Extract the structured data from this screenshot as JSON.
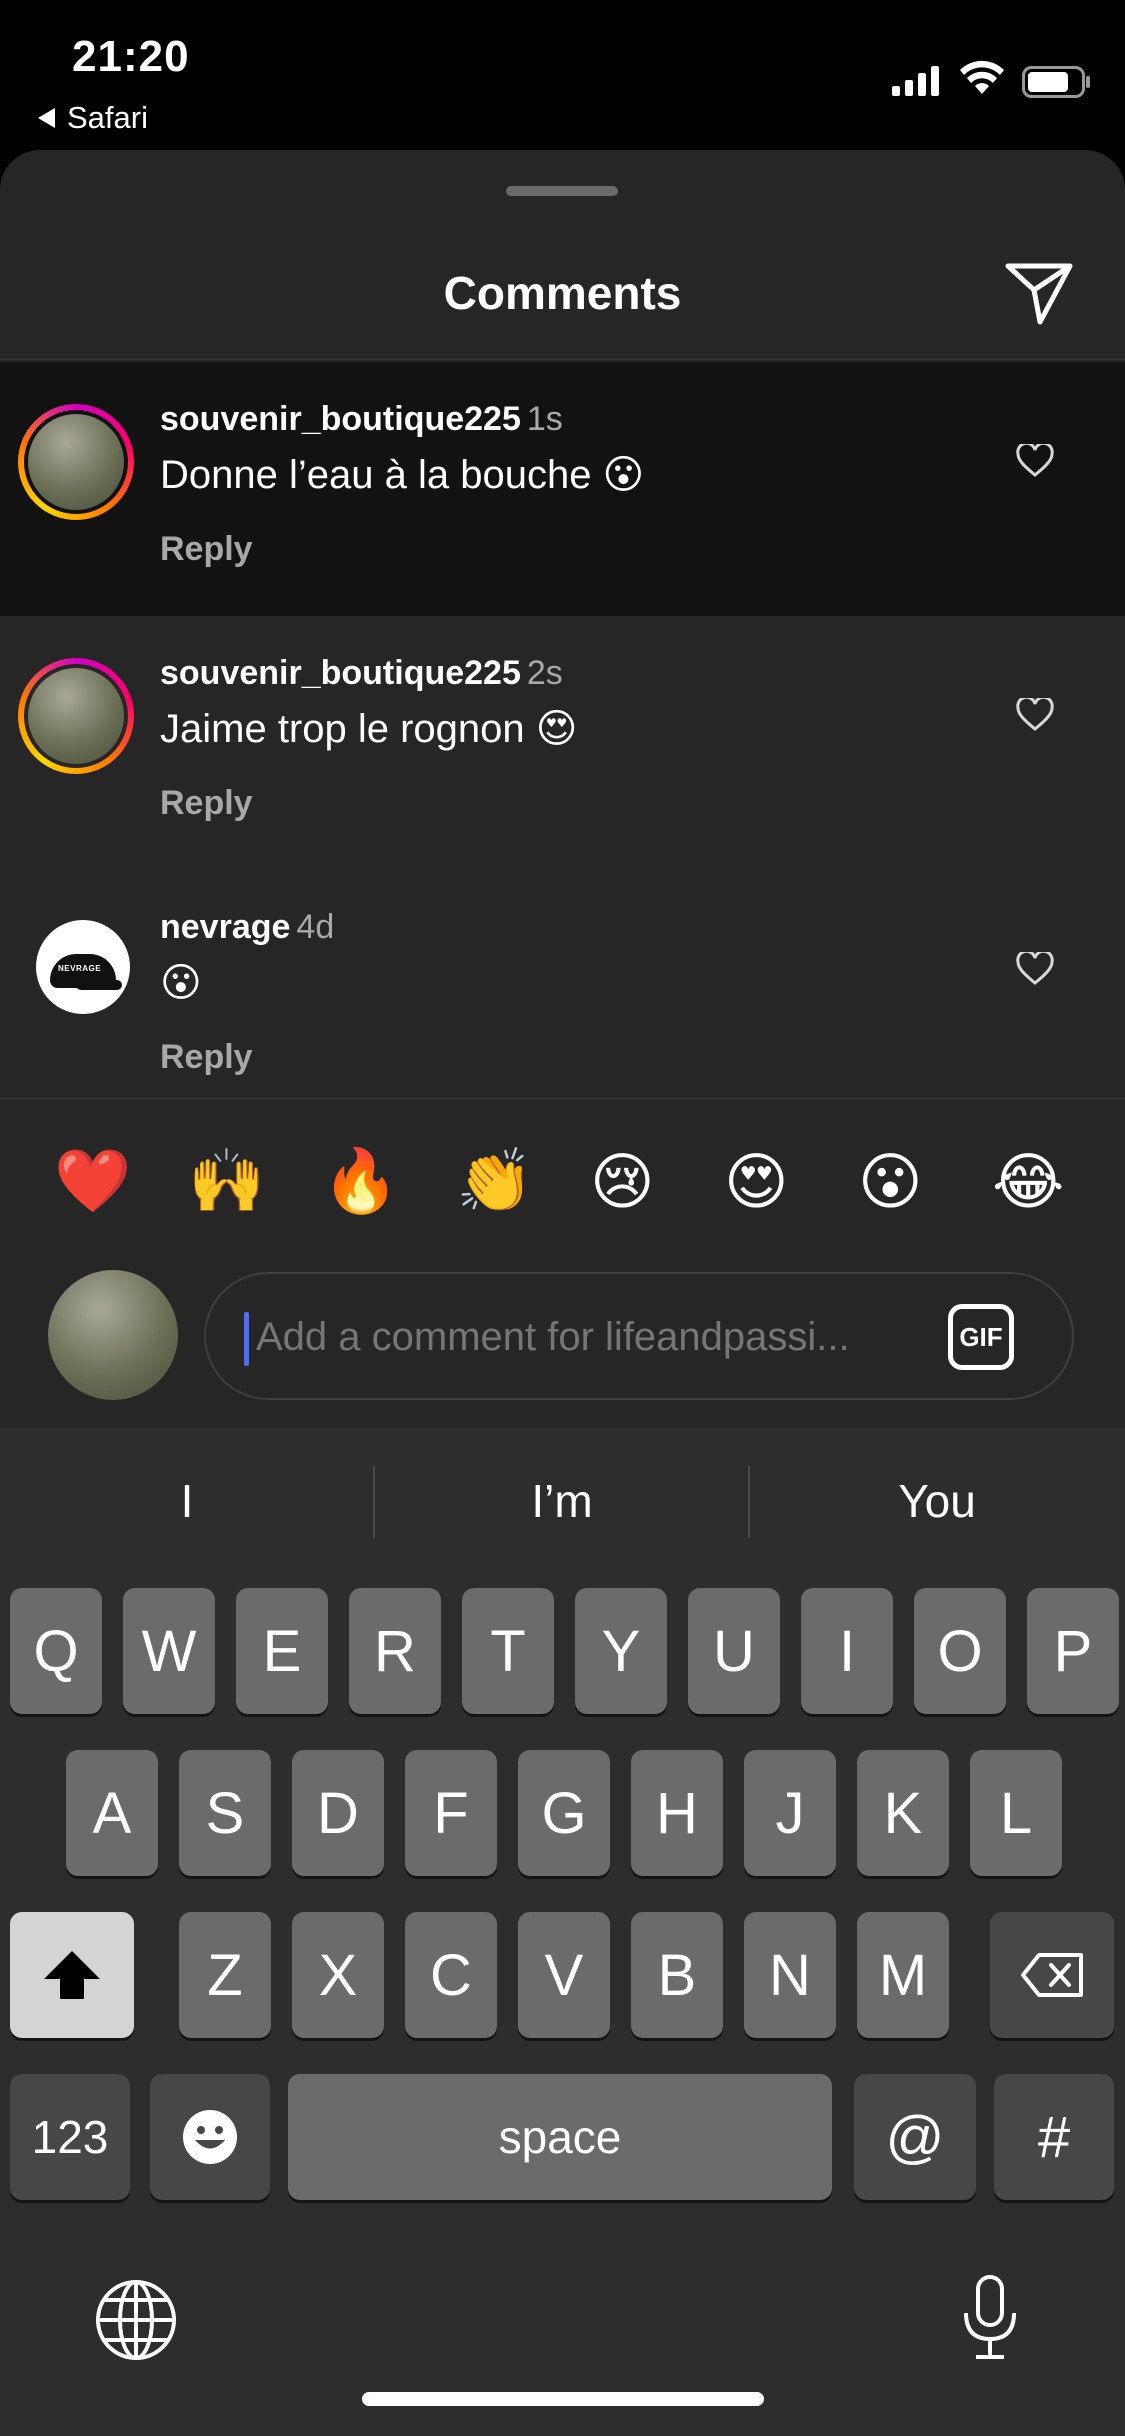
{
  "status_bar": {
    "time": "21:20",
    "back_app": "Safari",
    "icons": [
      "cellular-signal-icon",
      "wifi-icon",
      "battery-icon"
    ]
  },
  "header": {
    "title": "Comments",
    "send_icon": "paper-plane-icon"
  },
  "comments": [
    {
      "username": "souvenir_boutique225",
      "time": "1s",
      "text": "Donne l’eau à la bouche 😮",
      "reply": "Reply",
      "highlighted": true
    },
    {
      "username": "souvenir_boutique225",
      "time": "2s",
      "text": "Jaime trop le rognon 😍",
      "reply": "Reply",
      "highlighted": false
    },
    {
      "username": "nevrage",
      "time": "4d",
      "text": "😮",
      "reply": "Reply",
      "highlighted": false,
      "avatar_text": "NEVRAGE"
    }
  ],
  "quick_reactions": [
    "❤️",
    "🙌",
    "🔥",
    "👏",
    "😢",
    "😍",
    "😮",
    "😂"
  ],
  "composer": {
    "placeholder": "Add a comment for lifeandpassi...",
    "gif_label": "GIF"
  },
  "keyboard": {
    "suggestions": [
      "I",
      "I’m",
      "You"
    ],
    "row1": [
      "Q",
      "W",
      "E",
      "R",
      "T",
      "Y",
      "U",
      "I",
      "O",
      "P"
    ],
    "row2": [
      "A",
      "S",
      "D",
      "F",
      "G",
      "H",
      "J",
      "K",
      "L"
    ],
    "row3": [
      "Z",
      "X",
      "C",
      "V",
      "B",
      "N",
      "M"
    ],
    "numbers_key": "123",
    "space_key": "space",
    "at_key": "@",
    "hash_key": "#"
  },
  "colors": {
    "sheet_bg": "#262626",
    "highlight_bg": "#121212",
    "caret": "#4d6bff",
    "secondary_text": "#a8a8a8"
  }
}
